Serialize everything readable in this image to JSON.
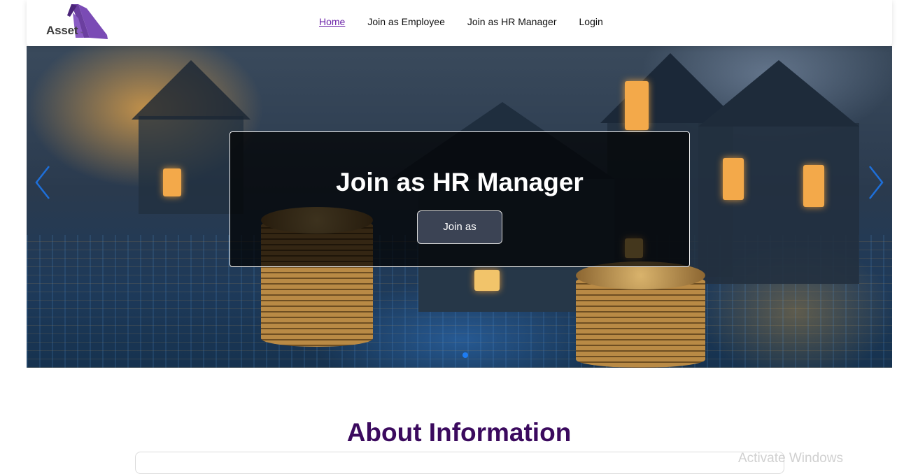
{
  "brand": {
    "logo_text": "Asset",
    "logo_tm": "™",
    "accent": "#6b21a8"
  },
  "nav": {
    "items": [
      {
        "label": "Home",
        "active": true
      },
      {
        "label": "Join as Employee",
        "active": false
      },
      {
        "label": "Join as HR Manager",
        "active": false
      },
      {
        "label": "Login",
        "active": false
      }
    ]
  },
  "hero": {
    "title": "Join as HR Manager",
    "button_label": "Join as",
    "prev_icon": "chevron-left-icon",
    "next_icon": "chevron-right-icon",
    "active_slide_color": "#1e7cf2"
  },
  "about": {
    "title": "About Information",
    "title_color": "#3b0a5e"
  },
  "watermark": {
    "text": "Activate Windows"
  }
}
